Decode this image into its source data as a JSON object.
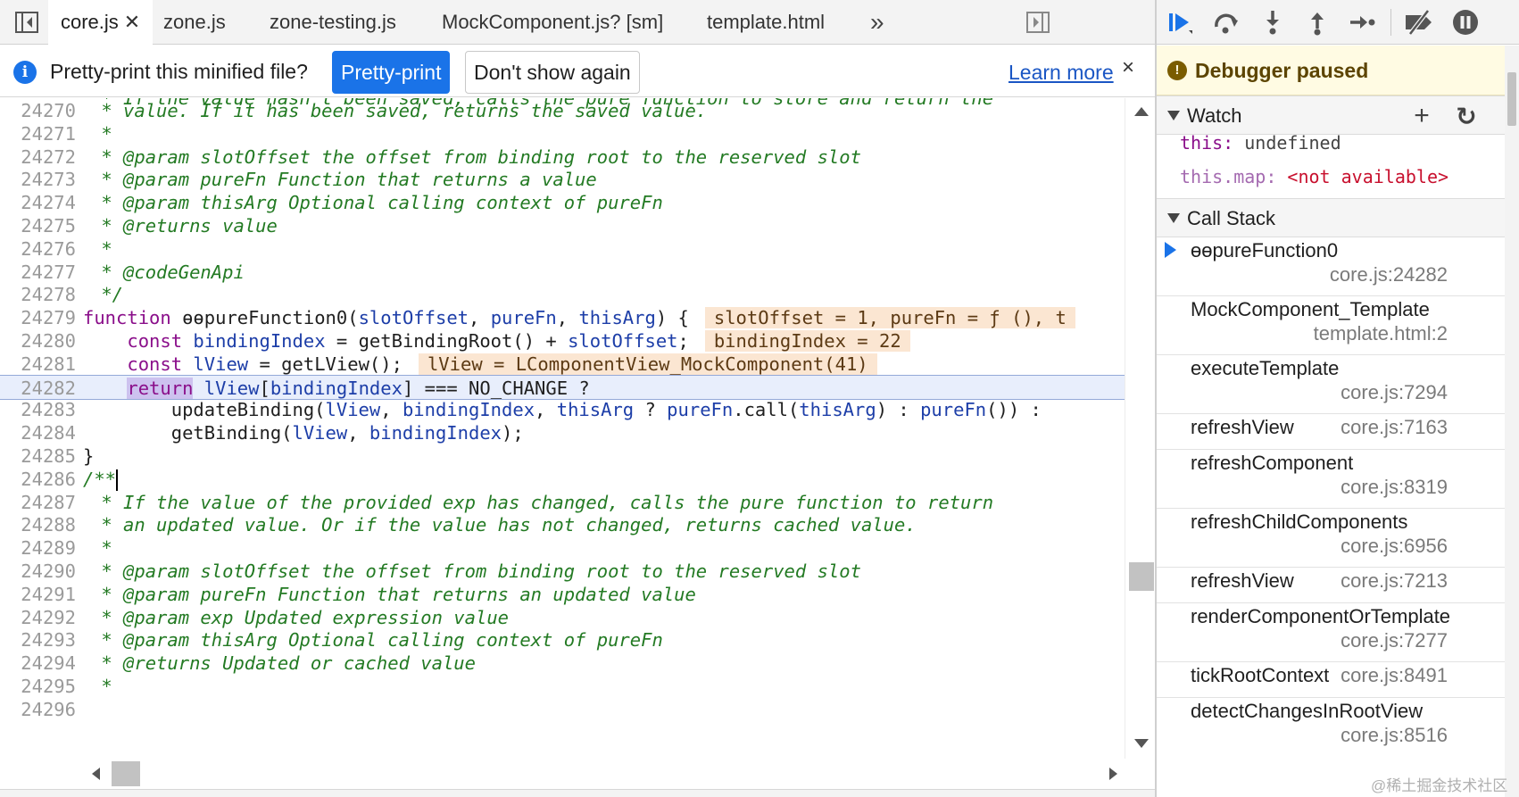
{
  "tabs": [
    {
      "label": "core.js",
      "active": true,
      "closable": true
    },
    {
      "label": "zone.js"
    },
    {
      "label": "zone-testing.js"
    },
    {
      "label": "MockComponent.js? [sm]"
    },
    {
      "label": "template.html"
    }
  ],
  "tabbar": {
    "more_icon": "double-chevron-right-icon",
    "toggle_navigator_icon": "sidebar-toggle-icon",
    "toggle_debugger_icon": "sidebar-toggle-icon",
    "more_glyph": "»"
  },
  "infobar": {
    "icon_glyph": "i",
    "text": "Pretty-print this minified file?",
    "primary_button": "Pretty-print",
    "secondary_button": "Don't show again",
    "link": "Learn more",
    "close_glyph": "×"
  },
  "editor": {
    "current_line": "24282",
    "cut_line_text": " * If the value hasn't been saved, calls the pure function to store and return the",
    "line_numbers": [
      "24270",
      "24271",
      "24272",
      "24273",
      "24274",
      "24275",
      "24276",
      "24277",
      "24278",
      "24279",
      "24280",
      "24281",
      "24282",
      "24283",
      "24284",
      "24285",
      "24286",
      "24287",
      "24288",
      "24289",
      "24290",
      "24291",
      "24292",
      "24293",
      "24294",
      "24295",
      "24296"
    ],
    "lines": {
      "l24270": " * value. If it has been saved, returns the saved value.",
      "l24271": " *",
      "l24272": " * @param slotOffset the offset from binding root to the reserved slot",
      "l24273": " * @param pureFn Function that returns a value",
      "l24274": " * @param thisArg Optional calling context of pureFn",
      "l24275": " * @returns value",
      "l24276": " *",
      "l24277": " * @codeGenApi",
      "l24278": " */",
      "l24279_kw": "function",
      "l24279_fn": " ɵɵpureFunction0(",
      "l24279_p1": "slotOffset",
      "l24279_c1": ", ",
      "l24279_p2": "pureFn",
      "l24279_c2": ", ",
      "l24279_p3": "thisArg",
      "l24279_end": ") {",
      "l24279_inline": "slotOffset = 1, pureFn = ƒ (), t",
      "l24280_kw": "    const",
      "l24280_var": " bindingIndex",
      "l24280_rest": " = getBindingRoot() + ",
      "l24280_var2": "slotOffset",
      "l24280_end": ";",
      "l24280_inline": "bindingIndex = 22",
      "l24281_kw": "    const",
      "l24281_var": " lView",
      "l24281_rest": " = getLView();",
      "l24281_inline": "lView = LComponentView_MockComponent(41)",
      "l24282_pre": "    ",
      "l24282_kw": "return",
      "l24282_sp": " ",
      "l24282_var": "lView",
      "l24282_br": "[",
      "l24282_var2": "bindingIndex",
      "l24282_rest": "] === NO_CHANGE ?",
      "l24283_pre": "        updateBinding(",
      "l24283_v1": "lView",
      "l24283_c1": ", ",
      "l24283_v2": "bindingIndex",
      "l24283_c2": ", ",
      "l24283_v3": "thisArg",
      "l24283_q": " ? ",
      "l24283_v4": "pureFn",
      "l24283_call": ".call(",
      "l24283_v5": "thisArg",
      "l24283_c3": ") : ",
      "l24283_v6": "pureFn",
      "l24283_end": "()) :",
      "l24284_pre": "        getBinding(",
      "l24284_v1": "lView",
      "l24284_c1": ", ",
      "l24284_v2": "bindingIndex",
      "l24284_end": ");",
      "l24285": "}",
      "l24286": "/**",
      "l24287": " * If the value of the provided exp has changed, calls the pure function to return",
      "l24288": " * an updated value. Or if the value has not changed, returns cached value.",
      "l24289": " *",
      "l24290": " * @param slotOffset the offset from binding root to the reserved slot",
      "l24291": " * @param pureFn Function that returns an updated value",
      "l24292": " * @param exp Updated expression value",
      "l24293": " * @param thisArg Optional calling context of pureFn",
      "l24294": " * @returns Updated or cached value",
      "l24295": " *",
      "l24296": ""
    }
  },
  "debugger": {
    "toolbar_icons": [
      "resume-icon",
      "step-over-icon",
      "step-into-icon",
      "step-out-icon",
      "step-icon",
      "deactivate-breakpoints-icon",
      "pause-on-exceptions-icon"
    ],
    "paused_icon_glyph": "!",
    "paused_text": "Debugger paused",
    "watch": {
      "title": "Watch",
      "add_glyph": "+",
      "refresh_glyph": "↻",
      "items": [
        {
          "name": "this",
          "colon": ":",
          "value": " undefined",
          "na": false
        },
        {
          "name": "this.map",
          "colon": ":",
          "value": " <not available>",
          "na": true
        }
      ]
    },
    "call_stack": {
      "title": "Call Stack",
      "frames": [
        {
          "name": "ɵɵpureFunction0",
          "location": "core.js:24282",
          "current": true,
          "two_line": true
        },
        {
          "name": "MockComponent_Template",
          "location": "template.html:2",
          "two_line": true
        },
        {
          "name": "executeTemplate",
          "location": "core.js:7294",
          "two_line": true
        },
        {
          "name": "refreshView",
          "location": "core.js:7163",
          "two_line": false
        },
        {
          "name": "refreshComponent",
          "location": "core.js:8319",
          "two_line": true
        },
        {
          "name": "refreshChildComponents",
          "location": "core.js:6956",
          "two_line": true
        },
        {
          "name": "refreshView",
          "location": "core.js:7213",
          "two_line": false
        },
        {
          "name": "renderComponentOrTemplate",
          "location": "core.js:7277",
          "two_line": true
        },
        {
          "name": "tickRootContext",
          "location": "core.js:8491",
          "two_line": false
        },
        {
          "name": "detectChangesInRootView",
          "location": "core.js:8516",
          "two_line": true
        }
      ]
    }
  },
  "watermark": "@稀土掘金技术社区",
  "colors": {
    "accent": "#1a73e8",
    "comment": "#237a23",
    "keyword": "#8a0e8a",
    "variable": "#1d3ea8",
    "inline_value_bg": "#fbe6d2",
    "current_line_bg": "#e8eefc",
    "paused_bg": "#fffbe3"
  }
}
